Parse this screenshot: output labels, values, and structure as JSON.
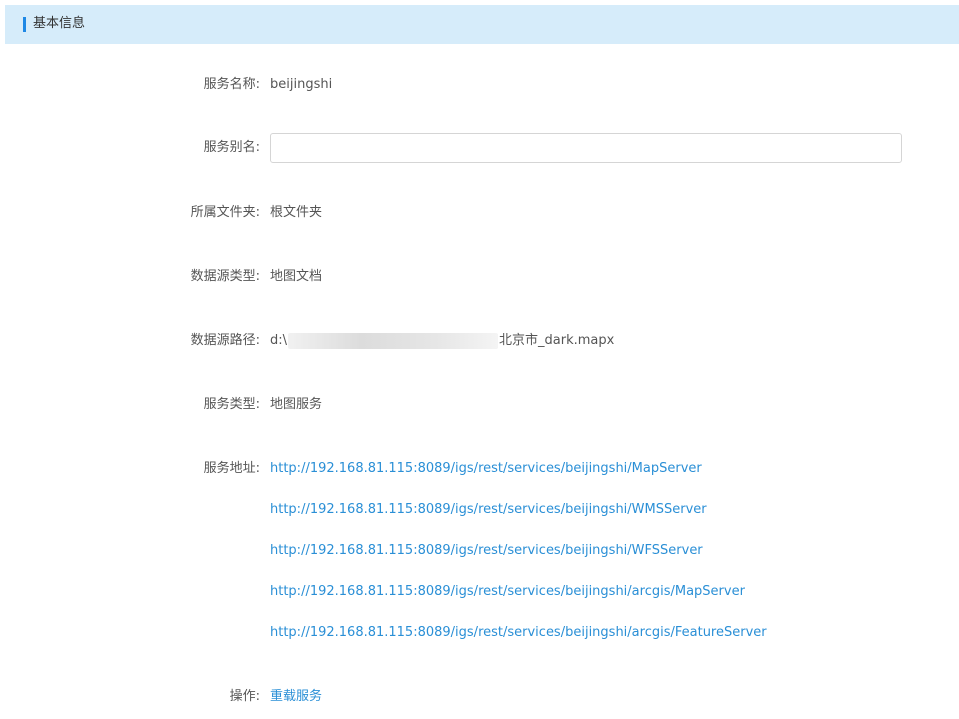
{
  "header": {
    "title": "基本信息"
  },
  "fields": {
    "service_name": {
      "label": "服务名称:",
      "value": "beijingshi"
    },
    "service_alias": {
      "label": "服务别名:",
      "value": "",
      "placeholder": ""
    },
    "folder": {
      "label": "所属文件夹:",
      "value": "根文件夹"
    },
    "datasource_type": {
      "label": "数据源类型:",
      "value": "地图文档"
    },
    "datasource_path": {
      "label": "数据源路径:",
      "prefix": "d:\\",
      "suffix": "北京市_dark.mapx"
    },
    "service_type": {
      "label": "服务类型:",
      "value": "地图服务"
    },
    "service_address": {
      "label": "服务地址:",
      "urls": [
        "http://192.168.81.115:8089/igs/rest/services/beijingshi/MapServer",
        "http://192.168.81.115:8089/igs/rest/services/beijingshi/WMSServer",
        "http://192.168.81.115:8089/igs/rest/services/beijingshi/WFSServer",
        "http://192.168.81.115:8089/igs/rest/services/beijingshi/arcgis/MapServer",
        "http://192.168.81.115:8089/igs/rest/services/beijingshi/arcgis/FeatureServer"
      ]
    },
    "operation": {
      "label": "操作:",
      "action": "重载服务"
    }
  },
  "colors": {
    "header_bg": "#d6ecfa",
    "accent_bar": "#1e88e5",
    "link": "#2a8fd6"
  }
}
